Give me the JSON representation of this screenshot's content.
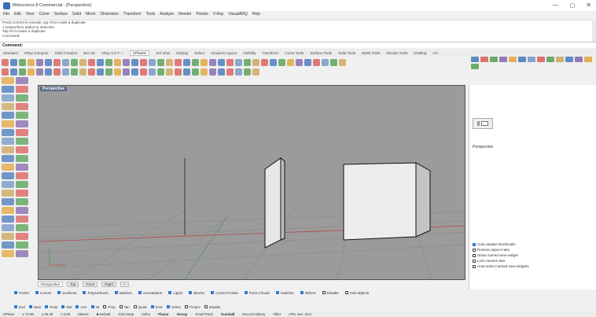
{
  "window": {
    "title": "Rhinoceros 8 Commercial - [Perspective]",
    "controls": [
      "—",
      "◻",
      "✕"
    ]
  },
  "menu": [
    "File",
    "Edit",
    "View",
    "Curve",
    "Surface",
    "Solid",
    "Mesh",
    "Dimension",
    "Transform",
    "Tools",
    "Analyze",
    "Render",
    "Panels",
    "V-Ray",
    "VisualARQ",
    "Help"
  ],
  "command_history": [
    "Press Control to extrude, tap Alt to make a duplicate",
    "1 polysurface added to selection.",
    "Tap Alt to make a duplicate",
    "Command:"
  ],
  "command_prompt": "Command:",
  "toolbar_tabs": [
    {
      "label": "Standard",
      "active": false
    },
    {
      "label": "VRay Compact",
      "active": false
    },
    {
      "label": "Solid Creation",
      "active": false
    },
    {
      "label": "Box 00",
      "active": false
    },
    {
      "label": "VRay Cre F □",
      "active": false
    },
    {
      "label": "CPlanes",
      "active": true
    },
    {
      "label": "Set View",
      "active": false
    },
    {
      "label": "Display",
      "active": false
    },
    {
      "label": "Select",
      "active": false
    },
    {
      "label": "Viewport Layout",
      "active": false
    },
    {
      "label": "Visibility",
      "active": false
    },
    {
      "label": "Transform",
      "active": false
    },
    {
      "label": "Curve Tools",
      "active": false
    },
    {
      "label": "Surface Tools",
      "active": false
    },
    {
      "label": "Solid Tools",
      "active": false
    },
    {
      "label": "Mesh Tools",
      "active": false
    },
    {
      "label": "Render Tools",
      "active": false
    },
    {
      "label": "Drafting",
      "active": false
    },
    {
      "label": "Arc",
      "active": false
    }
  ],
  "toolbar_icon_colors": [
    "#d9534f",
    "#3a6fb7",
    "#4a9a4a",
    "#e0a030",
    "#7b5ea7",
    "#3a6fb7",
    "#d9534f",
    "#6a8fc0",
    "#4a9a4a",
    "#c8a050"
  ],
  "viewport": {
    "label": "Perspective",
    "background": "#9b9b9b"
  },
  "viewport_tabs": [
    {
      "label": "Perspective",
      "active": true
    },
    {
      "label": "Top",
      "active": false
    },
    {
      "label": "Front",
      "active": false
    },
    {
      "label": "Right",
      "active": false
    },
    {
      "label": "+",
      "active": false
    }
  ],
  "selection_filters": [
    {
      "label": "Points",
      "checked": true
    },
    {
      "label": "Curves",
      "checked": true
    },
    {
      "label": "Surfaces",
      "checked": true
    },
    {
      "label": "Polysurfaces",
      "checked": true
    },
    {
      "label": "Meshes",
      "checked": true
    },
    {
      "label": "Annotations",
      "checked": true
    },
    {
      "label": "Lights",
      "checked": true
    },
    {
      "label": "Blocks",
      "checked": true
    },
    {
      "label": "Control Points",
      "checked": true
    },
    {
      "label": "Point Clouds",
      "checked": true
    },
    {
      "label": "Hatches",
      "checked": true
    },
    {
      "label": "Others",
      "checked": true
    },
    {
      "label": "Disable",
      "checked": false
    },
    {
      "label": "Sub-objects",
      "checked": false
    }
  ],
  "osnaps": [
    {
      "label": "End",
      "checked": true
    },
    {
      "label": "Near",
      "checked": true
    },
    {
      "label": "Point",
      "checked": true
    },
    {
      "label": "Mid",
      "checked": true
    },
    {
      "label": "Cen",
      "checked": true
    },
    {
      "label": "Int",
      "checked": true
    },
    {
      "label": "Perp",
      "checked": false
    },
    {
      "label": "Tan",
      "checked": false
    },
    {
      "label": "Quad",
      "checked": false
    },
    {
      "label": "Knot",
      "checked": true
    },
    {
      "label": "Vertex",
      "checked": true
    },
    {
      "label": "Project",
      "checked": false
    },
    {
      "label": "Disable",
      "checked": false
    }
  ],
  "status_bar": [
    {
      "label": "CPlane",
      "bold": false
    },
    {
      "label": "x 72.59",
      "bold": false
    },
    {
      "label": "y 48.39",
      "bold": false
    },
    {
      "label": "z 0.00",
      "bold": false
    },
    {
      "label": "Meters",
      "bold": false
    },
    {
      "label": "■ Default",
      "bold": false
    },
    {
      "label": "Grid Snap",
      "bold": false
    },
    {
      "label": "Ortho",
      "bold": false
    },
    {
      "label": "Planar",
      "bold": true
    },
    {
      "label": "Osnap",
      "bold": true
    },
    {
      "label": "SmartTrack",
      "bold": false
    },
    {
      "label": "Gumball",
      "bold": true
    },
    {
      "label": "Record History",
      "bold": false
    },
    {
      "label": "Filter",
      "bold": false
    },
    {
      "label": "CPU use: 10.0",
      "bold": false
    }
  ],
  "right_panel": {
    "icon_colors": [
      "#3a6fb7",
      "#d9534f",
      "#4a9a4a",
      "#7b5ea7",
      "#e0a030",
      "#3a6fb7",
      "#6a8fc0",
      "#d9534f",
      "#4a9a4a",
      "#c8a050",
      "#3a6fb7",
      "#7b5ea7",
      "#e0a030",
      "#4a9a4a"
    ],
    "named_view": "Perspective",
    "options": [
      {
        "label": "Auto-update thumbnails",
        "checked": true,
        "dim": false
      },
      {
        "label": "Restore aspect ratio",
        "checked": false,
        "dim": false
      },
      {
        "label": "Show named view widget",
        "checked": false,
        "dim": true
      },
      {
        "label": "Lock named view",
        "checked": false,
        "dim": true
      },
      {
        "label": "Auto-select named view widgets",
        "checked": false,
        "dim": false
      }
    ]
  }
}
